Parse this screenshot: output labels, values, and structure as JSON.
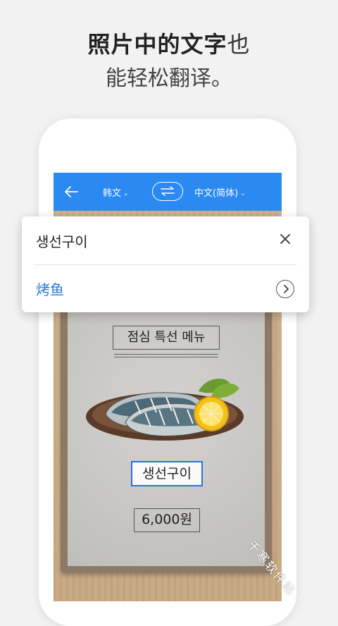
{
  "headline": {
    "line1_bold": "照片中的文字",
    "line1_light": "也",
    "line2": "能轻松翻译。"
  },
  "appbar": {
    "source_lang": "韩文",
    "target_lang": "中文(简体)"
  },
  "popup": {
    "source_text": "생선구이",
    "translation": "烤鱼"
  },
  "menu_board": {
    "title": "점심 특선 메뉴",
    "dish": "생선구이",
    "price": "6,000원"
  },
  "watermark": "千寒软件站",
  "colors": {
    "accent_blue": "#2b8af2",
    "translation_blue": "#2b7ad8",
    "highlight_border": "#2b6fe0"
  }
}
